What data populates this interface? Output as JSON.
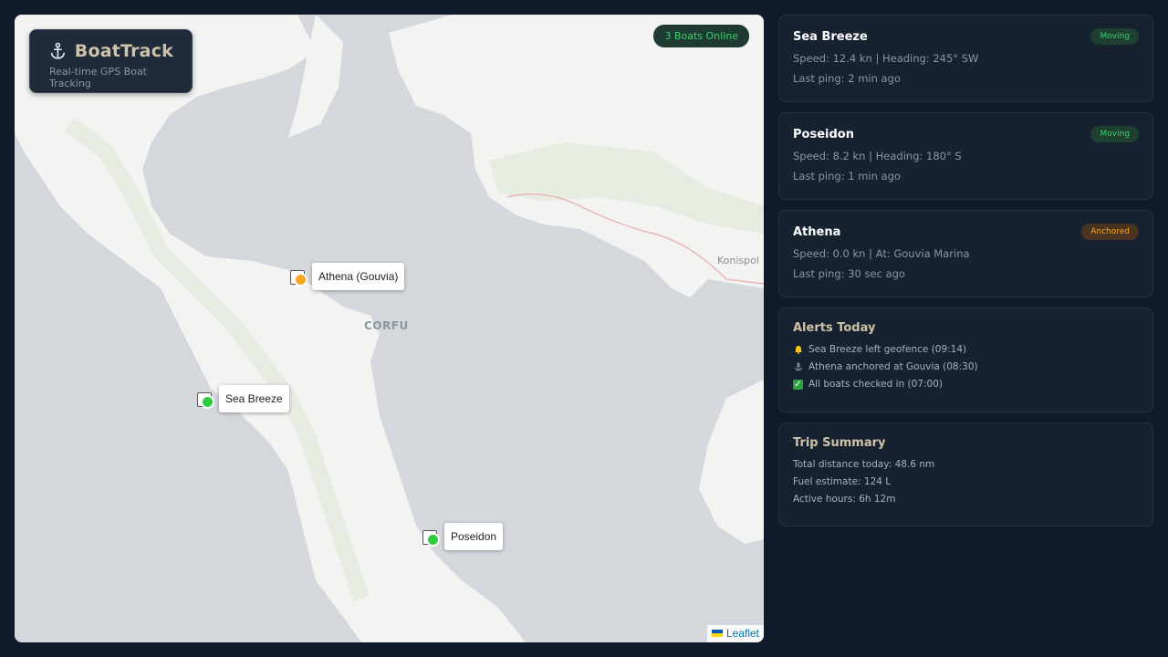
{
  "brand": {
    "title": "BoatTrack",
    "subtitle": "Real-time GPS Boat Tracking"
  },
  "online_badge": "3 Boats Online",
  "map": {
    "labels": {
      "island": "CORFU",
      "town": "Konispol"
    },
    "markers": [
      {
        "label": "Athena (Gouvia)",
        "status_color": "#f5a623"
      },
      {
        "label": "Sea Breeze",
        "status_color": "#2ecc40"
      },
      {
        "label": "Poseidon",
        "status_color": "#2ecc40"
      }
    ],
    "attribution": "Leaflet"
  },
  "boats": [
    {
      "name": "Sea Breeze",
      "status": "Moving",
      "line1": "Speed: 12.4 kn | Heading: 245° SW",
      "line2": "Last ping: 2 min ago"
    },
    {
      "name": "Poseidon",
      "status": "Moving",
      "line1": "Speed: 8.2 kn | Heading: 180° S",
      "line2": "Last ping: 1 min ago"
    },
    {
      "name": "Athena",
      "status": "Anchored",
      "line1": "Speed: 0.0 kn | At: Gouvia Marina",
      "line2": "Last ping: 30 sec ago"
    }
  ],
  "alerts": {
    "title": "Alerts Today",
    "items": [
      {
        "icon": "bell-icon",
        "text": "Sea Breeze left geofence (09:14)"
      },
      {
        "icon": "anchor-icon",
        "text": "Athena anchored at Gouvia (08:30)"
      },
      {
        "icon": "check-icon",
        "text": "All boats checked in (07:00)"
      }
    ]
  },
  "trip": {
    "title": "Trip Summary",
    "items": [
      "Total distance today: 48.6 nm",
      "Fuel estimate: 124 L",
      "Active hours: 6h 12m"
    ]
  },
  "colors": {
    "background": "#0f1b2a",
    "card": "#162230",
    "moving": "#37d16b",
    "anchored": "#f5a623",
    "accent": "#cfc2a8"
  }
}
